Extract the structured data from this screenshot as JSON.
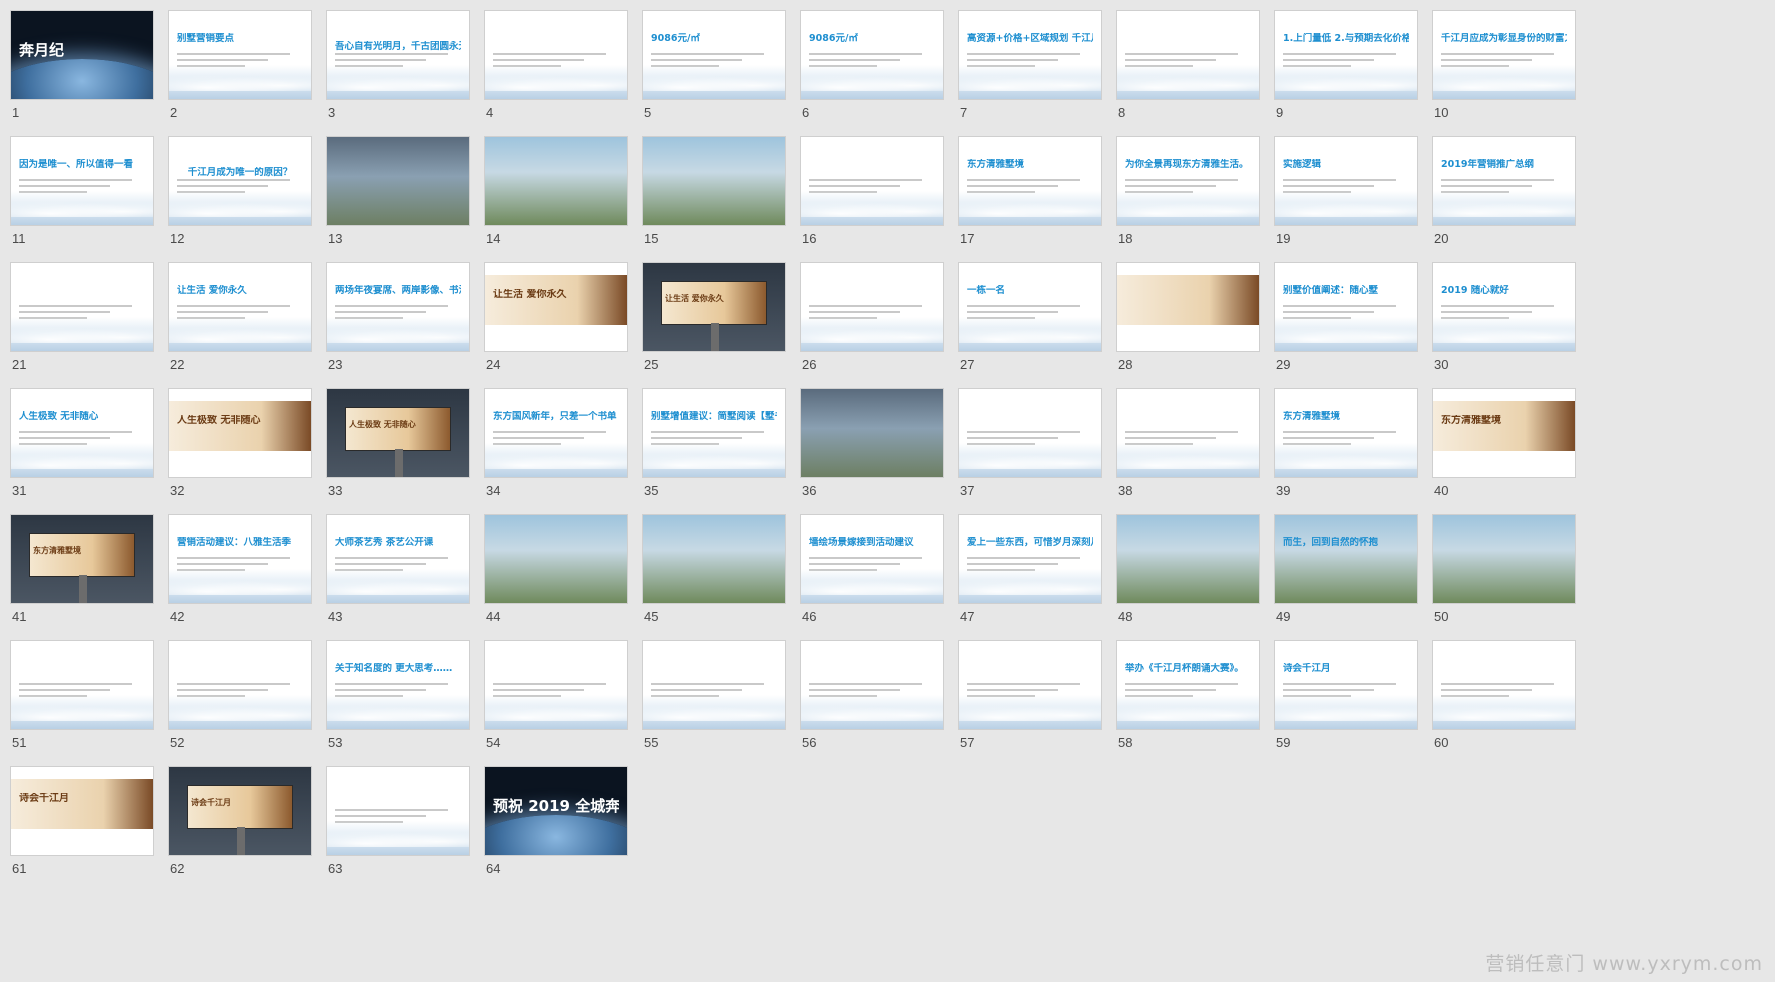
{
  "slides": [
    {
      "n": "1",
      "title": "奔月纪",
      "style": "dark"
    },
    {
      "n": "2",
      "title": "别墅营销要点",
      "style": "doc"
    },
    {
      "n": "3",
      "title": "吾心自有光明月，千古团圆永无缺。",
      "style": "center"
    },
    {
      "n": "4",
      "title": "",
      "style": "doc"
    },
    {
      "n": "5",
      "title": "9086元/㎡",
      "style": "doc"
    },
    {
      "n": "6",
      "title": "9086元/㎡",
      "style": "doc"
    },
    {
      "n": "7",
      "title": "高资源+价格+区域规划 千江月依旧是出路吗？",
      "style": "doc"
    },
    {
      "n": "8",
      "title": "",
      "style": "doc"
    },
    {
      "n": "9",
      "title": "1.上门量低 2.与预期去化价格",
      "style": "doc"
    },
    {
      "n": "10",
      "title": "千江月应成为彰显身份的财富之选",
      "style": "doc"
    },
    {
      "n": "11",
      "title": "因为是唯一、所以值得一看",
      "style": "doc"
    },
    {
      "n": "12",
      "title": "千江月成为唯一的原因？",
      "style": "center"
    },
    {
      "n": "13",
      "title": "",
      "style": "photo"
    },
    {
      "n": "14",
      "title": "",
      "style": "photo2"
    },
    {
      "n": "15",
      "title": "",
      "style": "photo2"
    },
    {
      "n": "16",
      "title": "",
      "style": "doc"
    },
    {
      "n": "17",
      "title": "东方清雅墅境",
      "style": "doc"
    },
    {
      "n": "18",
      "title": "为你全景再现东方清雅生活。",
      "style": "doc"
    },
    {
      "n": "19",
      "title": "实施逻辑",
      "style": "doc"
    },
    {
      "n": "20",
      "title": "2019年营销推广总纲",
      "style": "doc"
    },
    {
      "n": "21",
      "title": "",
      "style": "center"
    },
    {
      "n": "22",
      "title": "让生活 爱你永久",
      "style": "doc"
    },
    {
      "n": "23",
      "title": "两场年夜宴席、两岸影像、书法家现场定制春联",
      "style": "doc"
    },
    {
      "n": "24",
      "title": "让生活 爱你永久",
      "style": "beige"
    },
    {
      "n": "25",
      "title": "让生活 爱你永久",
      "style": "board"
    },
    {
      "n": "26",
      "title": "",
      "style": "center"
    },
    {
      "n": "27",
      "title": "一栋一名",
      "style": "doc"
    },
    {
      "n": "28",
      "title": "",
      "style": "beige"
    },
    {
      "n": "29",
      "title": "别墅价值阐述：随心墅",
      "style": "doc"
    },
    {
      "n": "30",
      "title": "2019 随心就好",
      "style": "doc"
    },
    {
      "n": "31",
      "title": "人生极致 无非随心",
      "style": "doc"
    },
    {
      "n": "32",
      "title": "人生极致 无非随心",
      "style": "beige"
    },
    {
      "n": "33",
      "title": "人生极致 无非随心",
      "style": "board"
    },
    {
      "n": "34",
      "title": "东方国风新年，只差一个书单",
      "style": "doc"
    },
    {
      "n": "35",
      "title": "别墅增值建议：简墅阅读【墅书馆】",
      "style": "doc"
    },
    {
      "n": "36",
      "title": "",
      "style": "photo"
    },
    {
      "n": "37",
      "title": "",
      "style": "doc"
    },
    {
      "n": "38",
      "title": "",
      "style": "center"
    },
    {
      "n": "39",
      "title": "东方清雅墅境",
      "style": "doc"
    },
    {
      "n": "40",
      "title": "东方清雅墅境",
      "style": "beige"
    },
    {
      "n": "41",
      "title": "东方清雅墅境",
      "style": "board"
    },
    {
      "n": "42",
      "title": "营销活动建议：八雅生活季",
      "style": "doc"
    },
    {
      "n": "43",
      "title": "大师茶艺秀 茶艺公开课",
      "style": "doc"
    },
    {
      "n": "44",
      "title": "",
      "style": "photo2"
    },
    {
      "n": "45",
      "title": "",
      "style": "photo2"
    },
    {
      "n": "46",
      "title": "墙绘场景嫁接到活动建议",
      "style": "doc"
    },
    {
      "n": "47",
      "title": "爱上一些东西，可惜岁月深刻月夜",
      "style": "doc"
    },
    {
      "n": "48",
      "title": "",
      "style": "photo2"
    },
    {
      "n": "49",
      "title": "而生，回到自然的怀抱",
      "style": "photo2"
    },
    {
      "n": "50",
      "title": "",
      "style": "photo2"
    },
    {
      "n": "51",
      "title": "",
      "style": "center"
    },
    {
      "n": "52",
      "title": "",
      "style": "doc"
    },
    {
      "n": "53",
      "title": "关于知名度的 更大思考……",
      "style": "doc"
    },
    {
      "n": "54",
      "title": "",
      "style": "doc"
    },
    {
      "n": "55",
      "title": "",
      "style": "doc"
    },
    {
      "n": "56",
      "title": "",
      "style": "doc"
    },
    {
      "n": "57",
      "title": "",
      "style": "doc"
    },
    {
      "n": "58",
      "title": "举办《千江月杯朗诵大赛》。",
      "style": "doc"
    },
    {
      "n": "59",
      "title": "诗会千江月",
      "style": "doc"
    },
    {
      "n": "60",
      "title": "",
      "style": "doc"
    },
    {
      "n": "61",
      "title": "诗会千江月",
      "style": "beige"
    },
    {
      "n": "62",
      "title": "诗会千江月",
      "style": "board"
    },
    {
      "n": "63",
      "title": "",
      "style": "doc"
    },
    {
      "n": "64",
      "title": "预祝 2019 全城奔月",
      "style": "dark"
    }
  ],
  "watermark": "营销任意门 www.yxrym.com"
}
